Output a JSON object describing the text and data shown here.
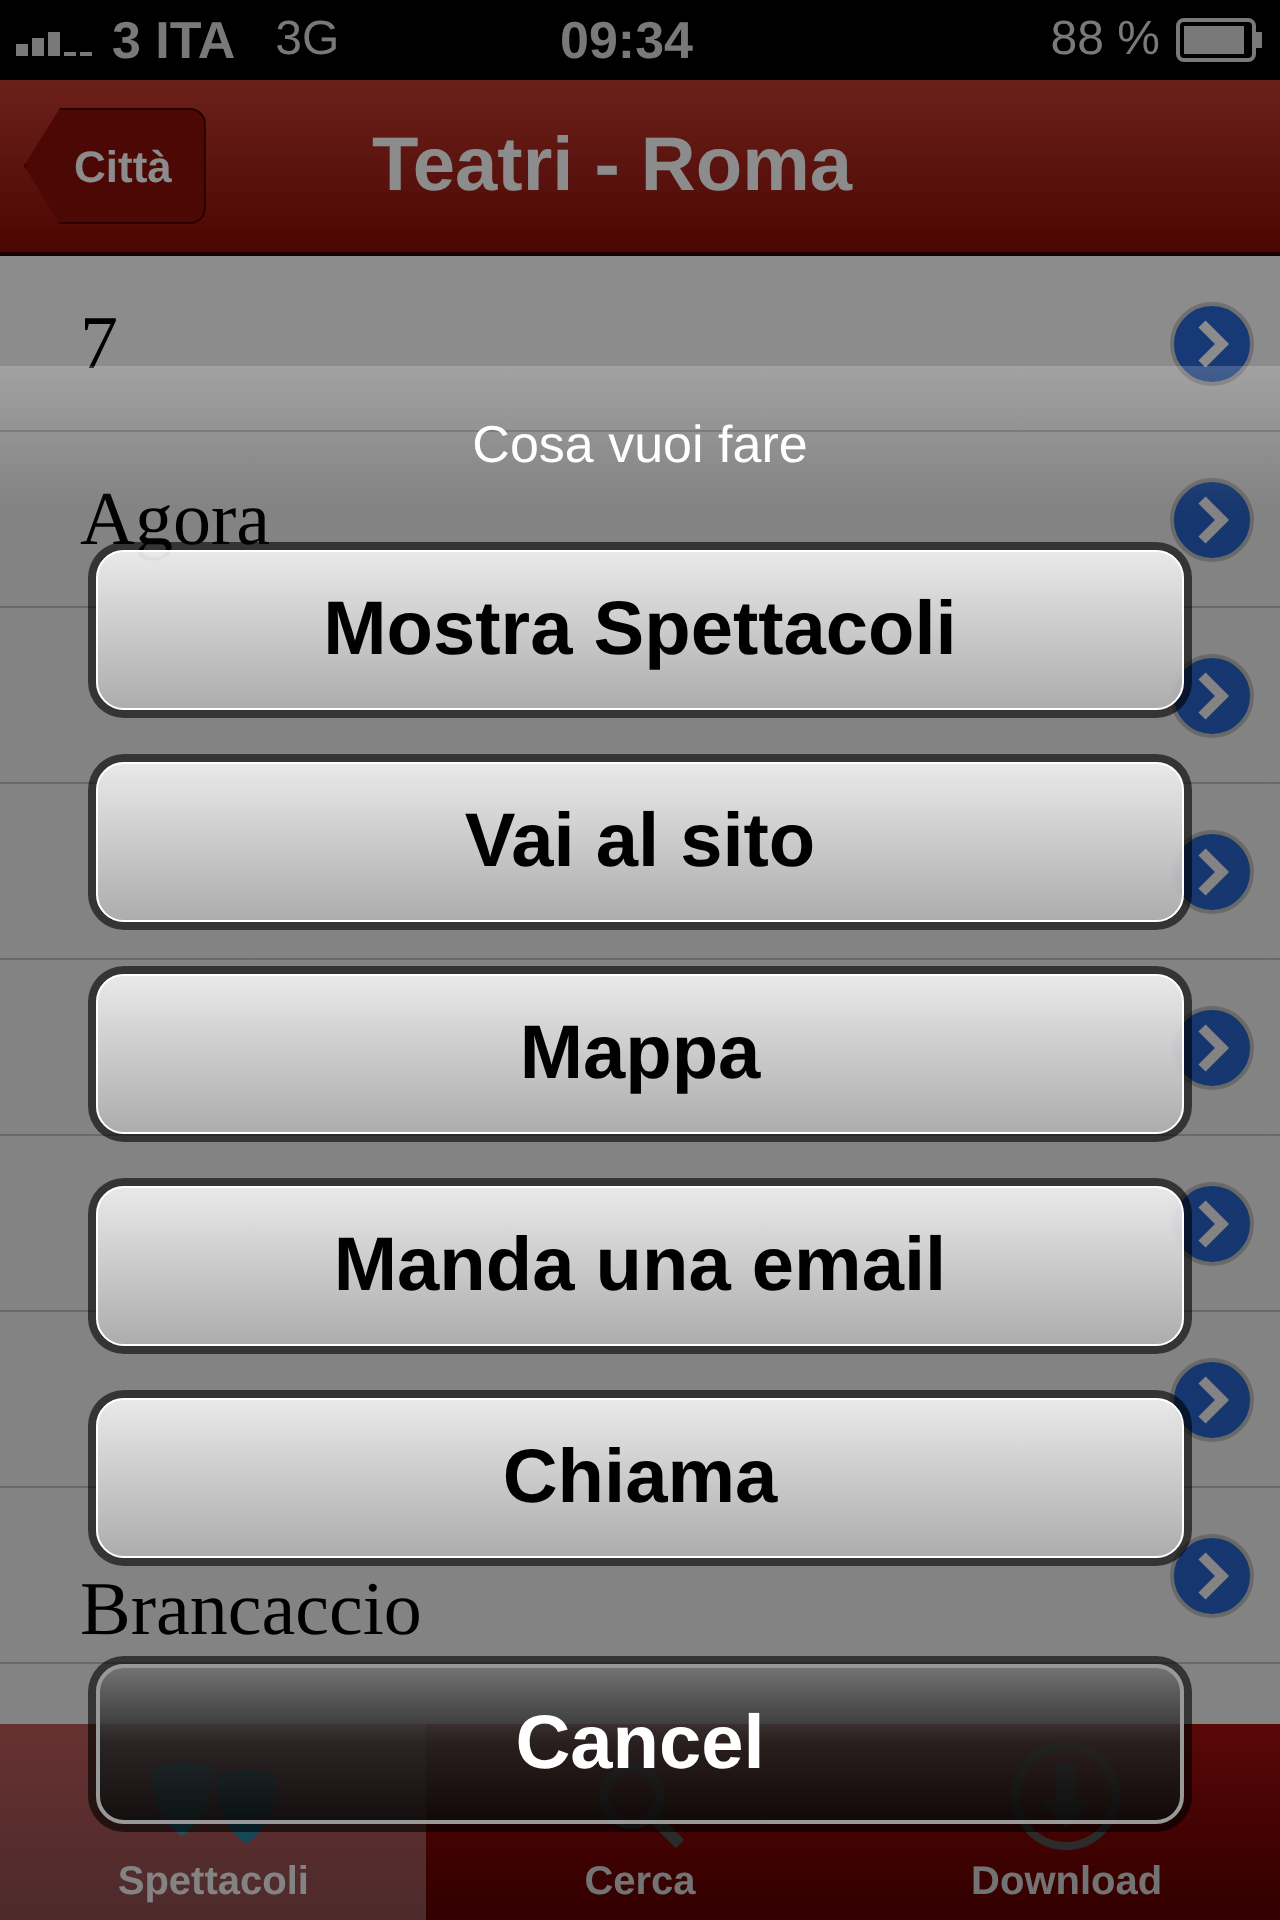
{
  "status_bar": {
    "carrier": "3 ITA",
    "network": "3G",
    "time": "09:34",
    "battery": "88 %"
  },
  "nav_bar": {
    "back": "Città",
    "title": "Teatri - Roma"
  },
  "rows": [
    {
      "name": "7"
    },
    {
      "name": "Agora"
    },
    {},
    {},
    {},
    {},
    {},
    {
      "name": "Brancaccio"
    }
  ],
  "tab_bar": [
    {
      "label": "Spettacoli",
      "selected": true
    },
    {
      "label": "Cerca",
      "selected": false
    },
    {
      "label": "Download",
      "selected": false
    }
  ],
  "action_sheet": {
    "title": "Cosa vuoi fare",
    "buttons": [
      {
        "label": "Mostra Spettacoli",
        "kind": "default"
      },
      {
        "label": "Vai al sito",
        "kind": "default"
      },
      {
        "label": "Mappa",
        "kind": "default"
      },
      {
        "label": "Manda una email",
        "kind": "default"
      },
      {
        "label": "Chiama",
        "kind": "default"
      },
      {
        "label": "Cancel",
        "kind": "cancel"
      }
    ]
  }
}
